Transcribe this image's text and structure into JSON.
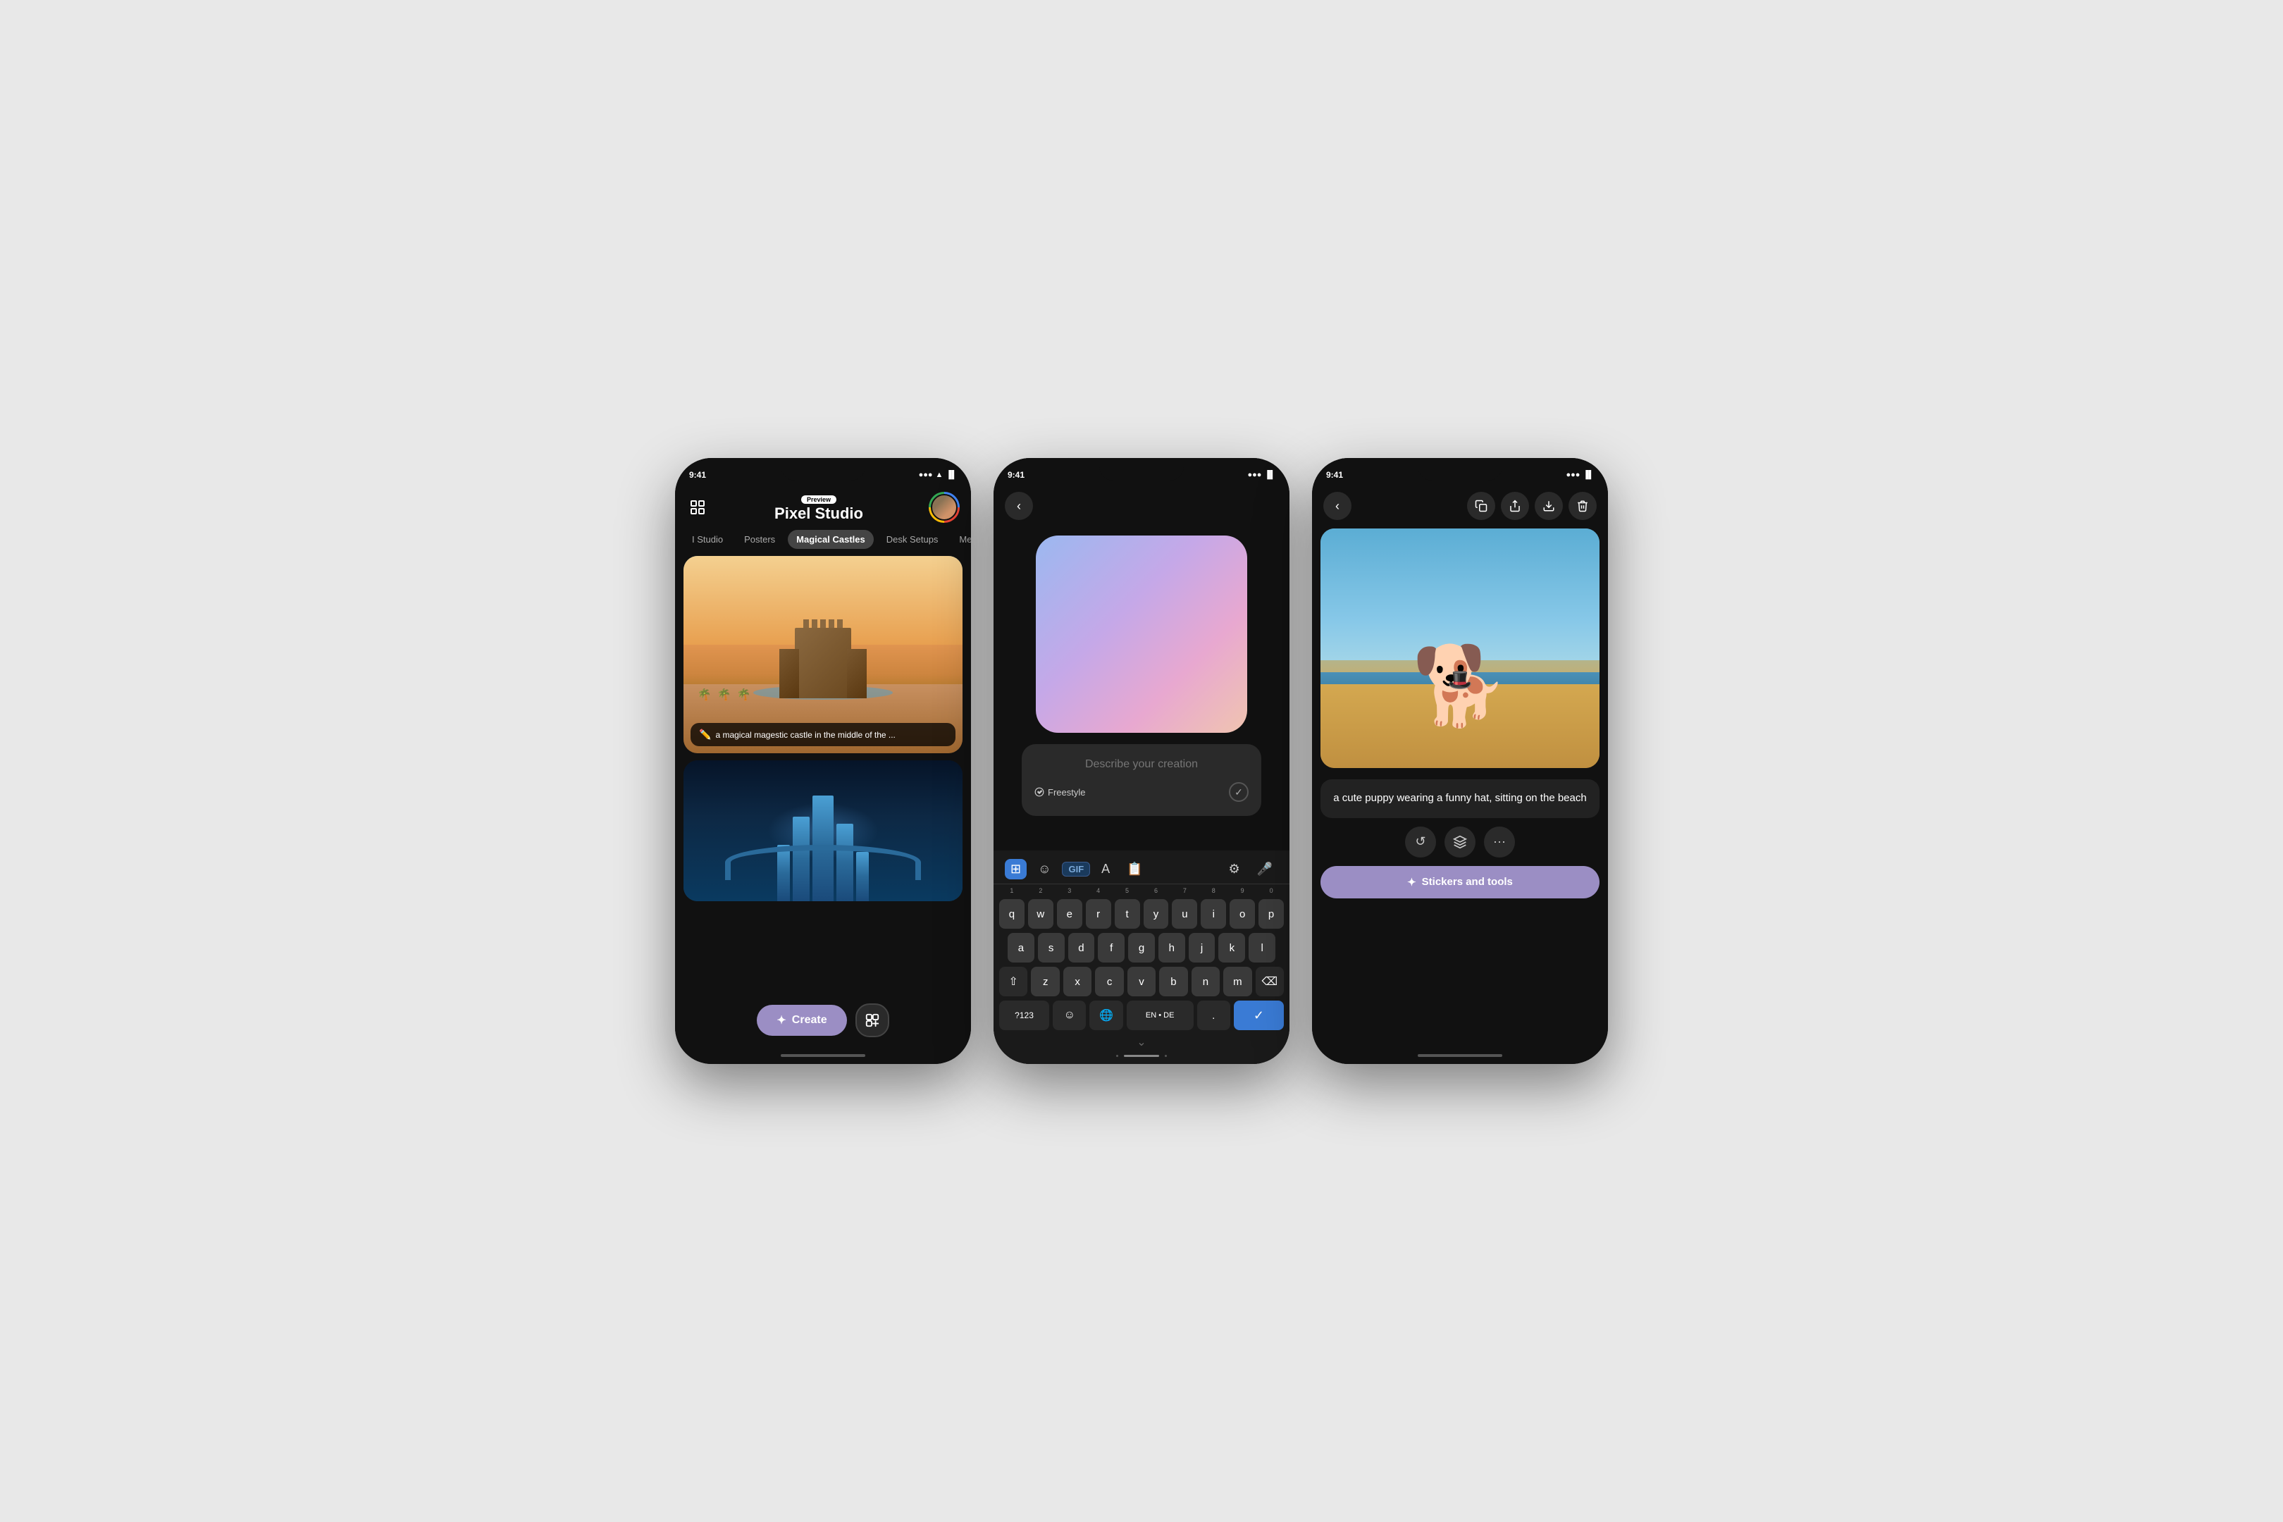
{
  "phone1": {
    "status": {
      "time": "9:41",
      "signal": "●●●",
      "wifi": "▲",
      "battery": "▐▌"
    },
    "header": {
      "preview_badge": "Preview",
      "title": "Pixel Studio"
    },
    "tabs": [
      {
        "label": "I Studio",
        "active": false
      },
      {
        "label": "Posters",
        "active": false
      },
      {
        "label": "Magical Castles",
        "active": true
      },
      {
        "label": "Desk Setups",
        "active": false
      },
      {
        "label": "Men...",
        "active": false
      }
    ],
    "image1_caption": "a magical magestic castle in the middle of the ...",
    "create_btn": "Create"
  },
  "phone2": {
    "status": {
      "time": "9:41"
    },
    "describe_placeholder": "Describe your creation",
    "freestyle_label": "Freestyle",
    "keyboard": {
      "numbers": [
        "1",
        "2",
        "3",
        "4",
        "5",
        "6",
        "7",
        "8",
        "9",
        "0"
      ],
      "row1": [
        "q",
        "w",
        "e",
        "r",
        "t",
        "y",
        "u",
        "i",
        "o",
        "p"
      ],
      "row2": [
        "a",
        "s",
        "d",
        "f",
        "g",
        "h",
        "j",
        "k",
        "l"
      ],
      "row3": [
        "z",
        "x",
        "c",
        "v",
        "b",
        "n",
        "m"
      ],
      "special_btn": "?123",
      "lang_btn": "EN • DE",
      "gif_btn": "GIF"
    }
  },
  "phone3": {
    "status": {
      "time": "9:41"
    },
    "prompt_text": "a cute puppy wearing a funny hat, sitting on the beach",
    "stickers_btn": "Stickers and tools"
  }
}
